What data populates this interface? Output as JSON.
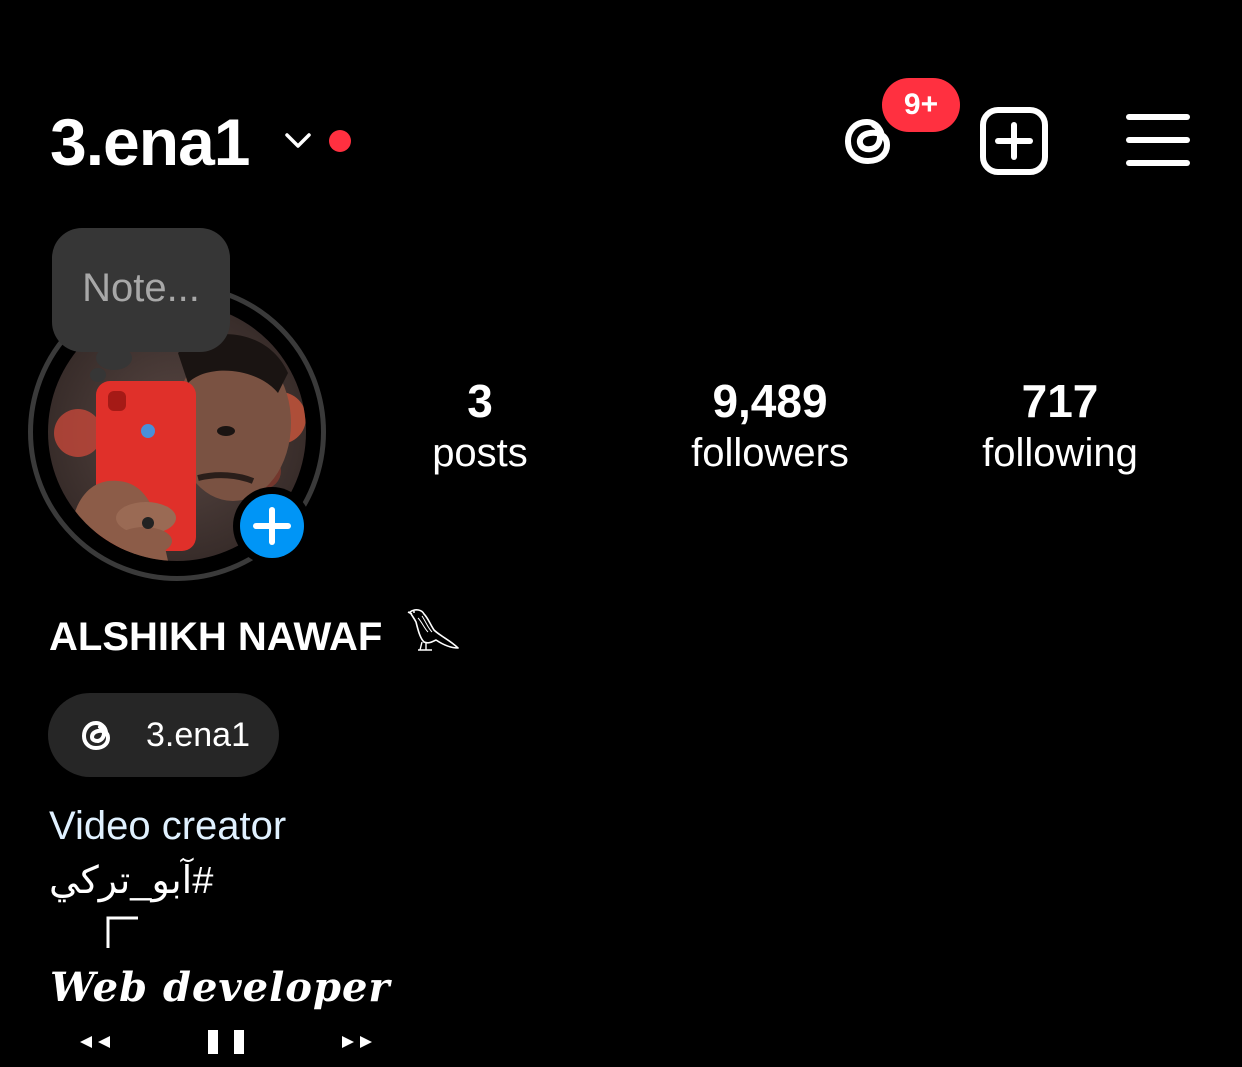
{
  "header": {
    "username": "3.ena1",
    "threads_badge": "9+"
  },
  "note": {
    "placeholder": "Note..."
  },
  "stats": [
    {
      "value": "3",
      "label": "posts"
    },
    {
      "value": "9,489",
      "label": "followers"
    },
    {
      "value": "717",
      "label": "following"
    }
  ],
  "profile": {
    "full_name": "ALSHIKH NAWAF",
    "threads_handle": "3.ena1"
  },
  "bio": {
    "category": "Video creator",
    "line1": "#آبو_تركي",
    "corner_glyph": "┌",
    "line2": "Web developer",
    "controls": [
      "◂◂",
      "❚❚",
      "▸▸"
    ]
  },
  "colors": {
    "background": "#000000",
    "badge": "#ff3040",
    "add_story": "#0095f6",
    "note_bg": "#363636",
    "pill_bg": "#262626",
    "category_text": "#e0f1ff"
  },
  "icons": {
    "chevron": "chevron-down-icon",
    "threads": "threads-icon",
    "create": "create-post-icon",
    "menu": "hamburger-menu-icon",
    "add_story": "plus-icon",
    "bird": "falcon-emoji-icon"
  }
}
